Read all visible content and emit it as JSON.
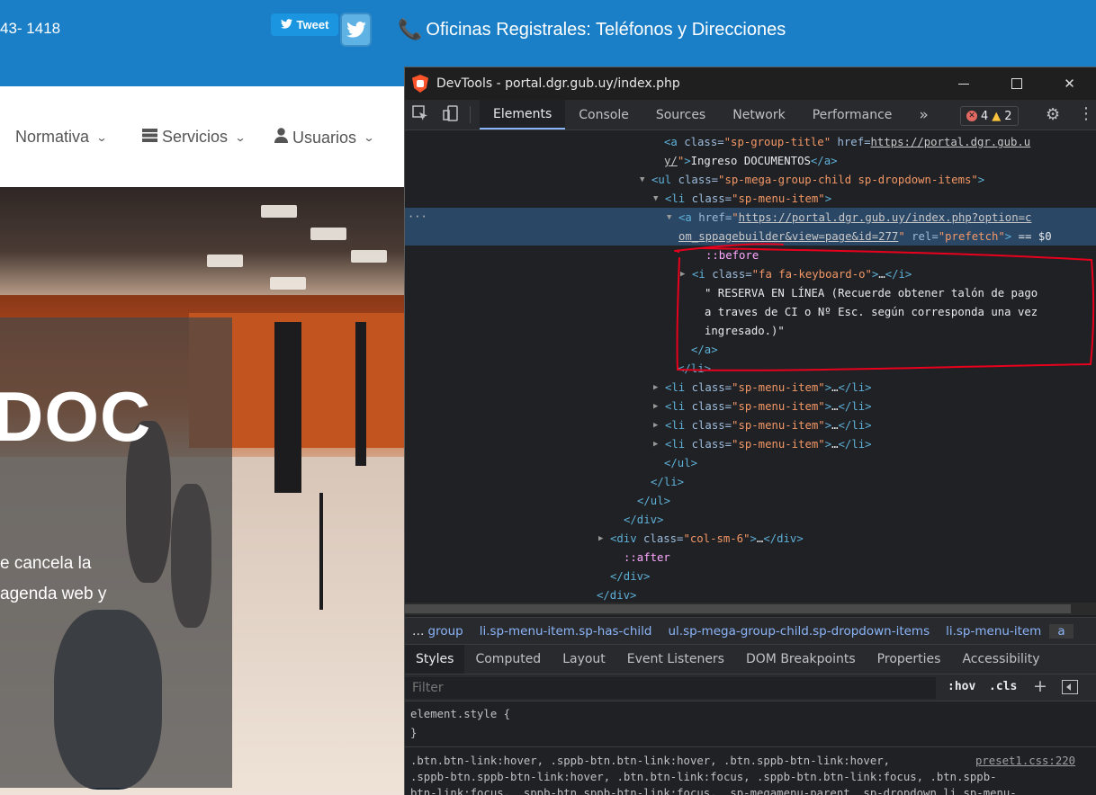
{
  "site": {
    "phone_partial": "43- 1418",
    "tweet_label": "Tweet",
    "offices_link": "Oficinas Registrales: Teléfonos y Direcciones",
    "nav": [
      {
        "label": "Normativa"
      },
      {
        "label": "Servicios"
      },
      {
        "label": "Usuarios"
      }
    ],
    "hero_title_partial": "DOC",
    "hero_text_line1": "e cancela la",
    "hero_text_line2": "agenda web y"
  },
  "devtools": {
    "window_title": "DevTools - portal.dgr.gub.uy/index.php",
    "tabs": [
      "Elements",
      "Console",
      "Sources",
      "Network",
      "Performance"
    ],
    "more_tabs": "»",
    "errors_count": "4",
    "warnings_count": "2",
    "dom_lines": [
      {
        "indent": 737,
        "parts": [
          [
            "tg",
            "<a "
          ],
          [
            "at",
            "class="
          ],
          [
            "av",
            "\"sp-group-title\" "
          ],
          [
            "at",
            "href="
          ],
          [
            "lk",
            "https://portal.dgr.gub.u"
          ]
        ]
      },
      {
        "indent": 737,
        "parts": [
          [
            "lk",
            "y/"
          ],
          [
            "av",
            "\""
          ],
          [
            "tg",
            ">"
          ],
          [
            "tx",
            "Ingreso DOCUMENTOS"
          ],
          [
            "tg",
            "</a>"
          ]
        ]
      },
      {
        "indent": 723,
        "arrow": "▼",
        "parts": [
          [
            "tg",
            "<ul "
          ],
          [
            "at",
            "class="
          ],
          [
            "av",
            "\"sp-mega-group-child sp-dropdown-items\""
          ],
          [
            "tg",
            ">"
          ]
        ]
      },
      {
        "indent": 738,
        "arrow": "▼",
        "parts": [
          [
            "tg",
            "<li "
          ],
          [
            "at",
            "class="
          ],
          [
            "av",
            "\"sp-menu-item\""
          ],
          [
            "tg",
            ">"
          ]
        ]
      },
      {
        "indent": 753,
        "arrow": "▼",
        "parts": [
          [
            "tg",
            "<a "
          ],
          [
            "at",
            "href="
          ],
          [
            "av",
            "\""
          ],
          [
            "lk",
            "https://portal.dgr.gub.uy/index.php?option=c"
          ]
        ]
      },
      {
        "indent": 753,
        "parts": [
          [
            "lk",
            "om_sppagebuilder&view=page&id=277"
          ],
          [
            "av",
            "\" "
          ],
          [
            "at",
            "rel="
          ],
          [
            "av",
            "\"prefetch\""
          ],
          [
            "tg",
            "> "
          ],
          [
            "tx",
            "== $0"
          ]
        ]
      },
      {
        "indent": 783,
        "parts": [
          [
            "ps",
            "::before"
          ]
        ]
      },
      {
        "indent": 768,
        "arrow": "▶",
        "parts": [
          [
            "tg",
            "<i "
          ],
          [
            "at",
            "class="
          ],
          [
            "av",
            "\"fa fa-keyboard-o\""
          ],
          [
            "tg",
            ">"
          ],
          [
            "tx",
            "…"
          ],
          [
            "tg",
            "</i>"
          ]
        ]
      },
      {
        "indent": 782,
        "parts": [
          [
            "tx",
            "\" RESERVA EN LÍNEA (Recuerde obtener talón de pago"
          ]
        ]
      },
      {
        "indent": 782,
        "parts": [
          [
            "tx",
            "a traves de CI o Nº Esc. según corresponda una vez"
          ]
        ]
      },
      {
        "indent": 782,
        "parts": [
          [
            "tx",
            "ingresado.)\""
          ]
        ]
      },
      {
        "indent": 767,
        "parts": [
          [
            "tg",
            "</a>"
          ]
        ]
      },
      {
        "indent": 752,
        "parts": [
          [
            "tg",
            "</li>"
          ]
        ]
      },
      {
        "indent": 738,
        "arrow": "▶",
        "parts": [
          [
            "tg",
            "<li "
          ],
          [
            "at",
            "class="
          ],
          [
            "av",
            "\"sp-menu-item\""
          ],
          [
            "tg",
            ">"
          ],
          [
            "tx",
            "…"
          ],
          [
            "tg",
            "</li>"
          ]
        ]
      },
      {
        "indent": 738,
        "arrow": "▶",
        "parts": [
          [
            "tg",
            "<li "
          ],
          [
            "at",
            "class="
          ],
          [
            "av",
            "\"sp-menu-item\""
          ],
          [
            "tg",
            ">"
          ],
          [
            "tx",
            "…"
          ],
          [
            "tg",
            "</li>"
          ]
        ]
      },
      {
        "indent": 738,
        "arrow": "▶",
        "parts": [
          [
            "tg",
            "<li "
          ],
          [
            "at",
            "class="
          ],
          [
            "av",
            "\"sp-menu-item\""
          ],
          [
            "tg",
            ">"
          ],
          [
            "tx",
            "…"
          ],
          [
            "tg",
            "</li>"
          ]
        ]
      },
      {
        "indent": 738,
        "arrow": "▶",
        "parts": [
          [
            "tg",
            "<li "
          ],
          [
            "at",
            "class="
          ],
          [
            "av",
            "\"sp-menu-item\""
          ],
          [
            "tg",
            ">"
          ],
          [
            "tx",
            "…"
          ],
          [
            "tg",
            "</li>"
          ]
        ]
      },
      {
        "indent": 737,
        "parts": [
          [
            "tg",
            "</ul>"
          ]
        ]
      },
      {
        "indent": 722,
        "parts": [
          [
            "tg",
            "</li>"
          ]
        ]
      },
      {
        "indent": 707,
        "parts": [
          [
            "tg",
            "</ul>"
          ]
        ]
      },
      {
        "indent": 692,
        "parts": [
          [
            "tg",
            "</div>"
          ]
        ]
      },
      {
        "indent": 677,
        "arrow": "▶",
        "parts": [
          [
            "tg",
            "<div "
          ],
          [
            "at",
            "class="
          ],
          [
            "av",
            "\"col-sm-6\""
          ],
          [
            "tg",
            ">"
          ],
          [
            "tx",
            "…"
          ],
          [
            "tg",
            "</div>"
          ]
        ]
      },
      {
        "indent": 692,
        "parts": [
          [
            "ps",
            "::after"
          ]
        ]
      },
      {
        "indent": 677,
        "parts": [
          [
            "tg",
            "</div>"
          ]
        ]
      },
      {
        "indent": 662,
        "parts": [
          [
            "tg",
            "</div>"
          ]
        ]
      }
    ],
    "breadcrumbs": [
      "…",
      "group",
      "li.sp-menu-item.sp-has-child",
      "ul.sp-mega-group-child.sp-dropdown-items",
      "li.sp-menu-item",
      "a"
    ],
    "sub_tabs": [
      "Styles",
      "Computed",
      "Layout",
      "Event Listeners",
      "DOM Breakpoints",
      "Properties",
      "Accessibility"
    ],
    "filter_placeholder": "Filter",
    "hov_label": ":hov",
    "cls_label": ".cls",
    "element_style_open": "element.style {",
    "element_style_close": "}",
    "rule_selector_lines": [
      ".btn.btn-link:hover, .sppb-btn.btn-link:hover, .btn.sppb-btn-link:hover,",
      ".sppb-btn.sppb-btn-link:hover, .btn.btn-link:focus, .sppb-btn.btn-link:focus, .btn.sppb-",
      "btn-link:focus, .sppb-btn.sppb-btn-link:focus, .sp-megamenu-parent .sp-dropdown li.sp-menu-"
    ],
    "rule_source": "preset1.css:220"
  },
  "colors": {
    "site_topbar": "#1b7fc7",
    "devtools_bg": "#202124",
    "selected_row": "#2b4766",
    "annotation_red": "#e8001c"
  }
}
